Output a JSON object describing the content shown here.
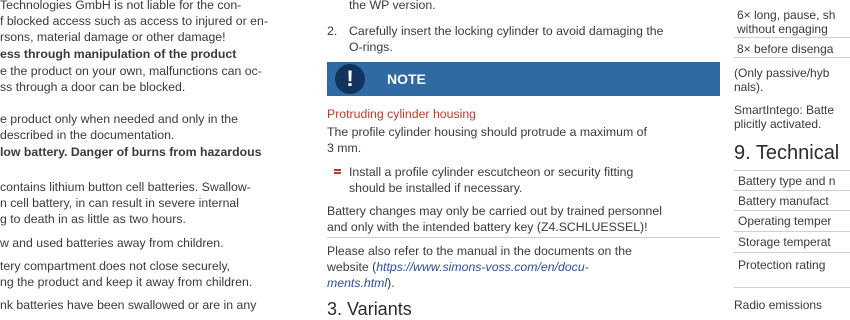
{
  "left": {
    "lines": [
      "Technologies GmbH is not liable for the con-",
      "f blocked access such as access to injured or en-",
      "rsons, material damage or other damage!",
      "ess through manipulation of the product",
      "e the product on your own, malfunctions can oc-",
      "ss through a door can be blocked.",
      "e product only when needed and only in the",
      "described in the documentation.",
      "low battery. Danger of burns from hazardous",
      "contains lithium button cell batteries. Swallow-",
      "n cell battery, in can result in severe internal",
      "g to death in as little as two hours.",
      "w and used batteries away from children.",
      "tery compartment does not close securely,",
      "ng the product and keep it away from children.",
      "nk batteries have been swallowed or are in any"
    ]
  },
  "middle": {
    "wp_version": "the WP version.",
    "step2_num": "2.",
    "step2_line1": "Carefully insert the locking cylinder to avoid damaging the",
    "step2_line2": "O-rings.",
    "note_icon": "!",
    "note_label": "NOTE",
    "protruding_heading": "Protruding cylinder housing",
    "protruding_text1": "The profile cylinder housing should protrude a maximum of",
    "protruding_text2": "3 mm.",
    "bullet_line1": "Install a profile cylinder escutcheon or security fitting",
    "bullet_line2": "should be installed if necessary.",
    "battery_change1": "Battery changes may only be carried out by trained personnel",
    "battery_change2": "and only with the intended battery key (Z4.SCHLUESSEL)!",
    "refer1": "Please also refer to the manual in the documents on the",
    "refer2_prefix": "website (",
    "refer2_link": "https://www.simons-voss.com/en/docu-",
    "refer3_link": "ments.html",
    "refer3_suffix": ").",
    "section_next": "3. Variants"
  },
  "right": {
    "row1a": "6× long, pause, sh",
    "row1b": "without engaging",
    "row2": "8× before disenga",
    "note1a": "(Only passive/hyb",
    "note1b": "nals).",
    "note2a": "SmartIntego: Batte",
    "note2b": "plicitly activated.",
    "section_title": "9. Technical",
    "table": [
      "Battery type and n",
      "Battery manufact",
      "Operating temper",
      "Storage temperat",
      "Protection rating"
    ],
    "radio": "Radio emissions"
  },
  "colors": {
    "text": "#3a3a3a",
    "red": "#c0392b",
    "note_bg": "#2f6aa3",
    "note_icon_bg": "#11335e",
    "link": "#2a4f9f"
  }
}
